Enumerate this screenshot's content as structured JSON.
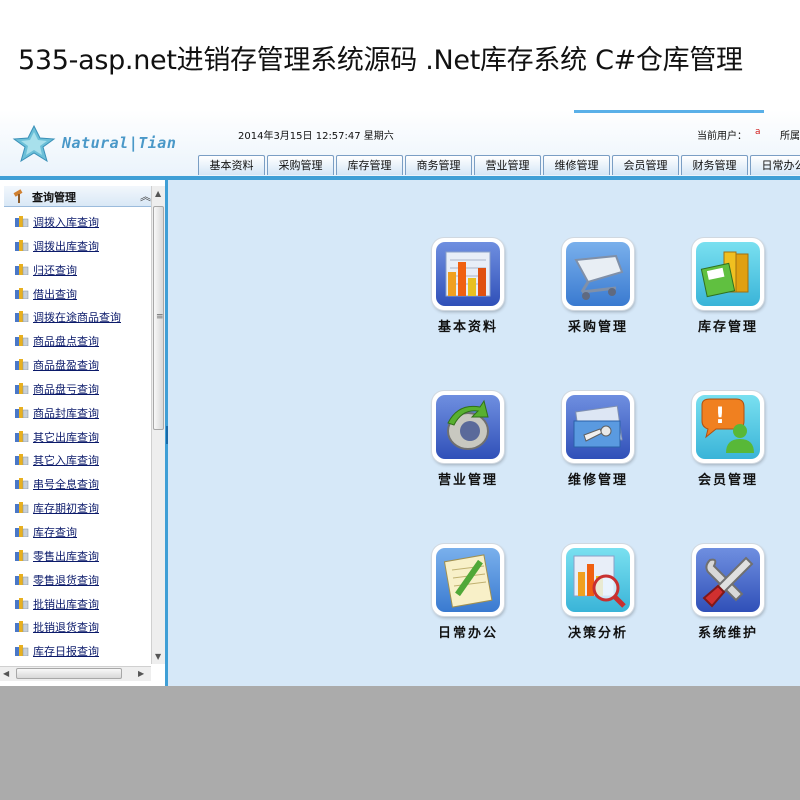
{
  "banner": {
    "text": "535-asp.net进销存管理系统源码 .Net库存系统 C#仓库管理"
  },
  "header": {
    "logo_text": "Natural|Tian",
    "datetime": "2014年3月15日  12:57:47  星期六",
    "user_label": "当前用户：",
    "user_name": "a",
    "belong_label": "所属"
  },
  "nav": {
    "tabs": [
      {
        "label": "基本资料"
      },
      {
        "label": "采购管理"
      },
      {
        "label": "库存管理"
      },
      {
        "label": "商务管理"
      },
      {
        "label": "营业管理"
      },
      {
        "label": "维修管理"
      },
      {
        "label": "会员管理"
      },
      {
        "label": "财务管理"
      },
      {
        "label": "日常办公"
      }
    ]
  },
  "sidebar": {
    "title": "查询管理",
    "items": [
      {
        "label": "调拨入库查询"
      },
      {
        "label": "调拨出库查询"
      },
      {
        "label": "归还查询"
      },
      {
        "label": "借出查询"
      },
      {
        "label": "调拨在途商品查询"
      },
      {
        "label": "商品盘点查询"
      },
      {
        "label": "商品盘盈查询"
      },
      {
        "label": "商品盘亏查询"
      },
      {
        "label": "商品封库查询"
      },
      {
        "label": "其它出库查询"
      },
      {
        "label": "其它入库查询"
      },
      {
        "label": "串号全息查询"
      },
      {
        "label": "库存期初查询"
      },
      {
        "label": "库存查询"
      },
      {
        "label": "零售出库查询"
      },
      {
        "label": "零售退货查询"
      },
      {
        "label": "批销出库查询"
      },
      {
        "label": "批销退货查询"
      },
      {
        "label": "库存日报查询"
      }
    ]
  },
  "modules": [
    {
      "label": "基本资料",
      "icon": "bar-chart-icon"
    },
    {
      "label": "采购管理",
      "icon": "shopping-cart-icon"
    },
    {
      "label": "库存管理",
      "icon": "books-floppy-icon"
    },
    {
      "label": "营业管理",
      "icon": "recycle-icon"
    },
    {
      "label": "维修管理",
      "icon": "tools-card-icon"
    },
    {
      "label": "会员管理",
      "icon": "member-chat-icon"
    },
    {
      "label": "日常办公",
      "icon": "notebook-pencil-icon"
    },
    {
      "label": "决策分析",
      "icon": "chart-magnifier-icon"
    },
    {
      "label": "系统维护",
      "icon": "wrench-screwdriver-icon"
    }
  ]
}
